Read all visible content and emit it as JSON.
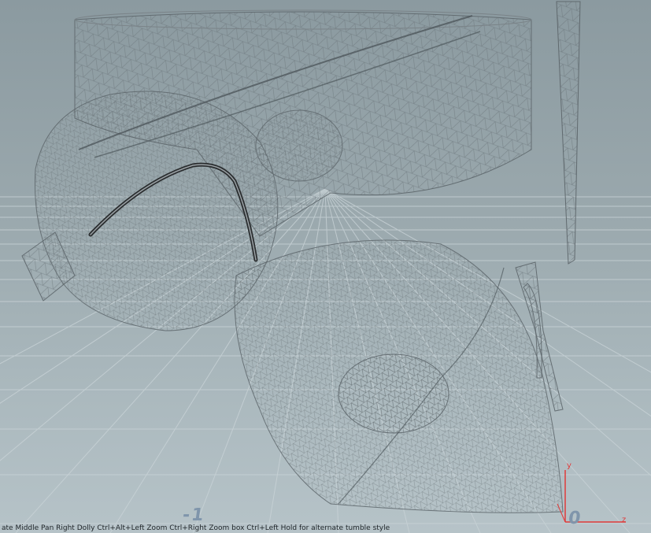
{
  "viewport": {
    "background_color": "#9aa8ad",
    "grid_color": "#c9d3d7",
    "mesh_color": "#6b7479",
    "curve_color": "#2a2d2f",
    "axis_color": "#e03a3a"
  },
  "grid_labels": {
    "minus_one": "-1",
    "zero": "0"
  },
  "axis_gizmo": {
    "y_label": "y",
    "z_label": "z"
  },
  "status_bar": {
    "text": "ate    Middle     Pan     Right    Dolly    Ctrl+Alt+Left     Zoom    Ctrl+Right      Zoom box    Ctrl+Left Hold for alternate tumble style"
  }
}
